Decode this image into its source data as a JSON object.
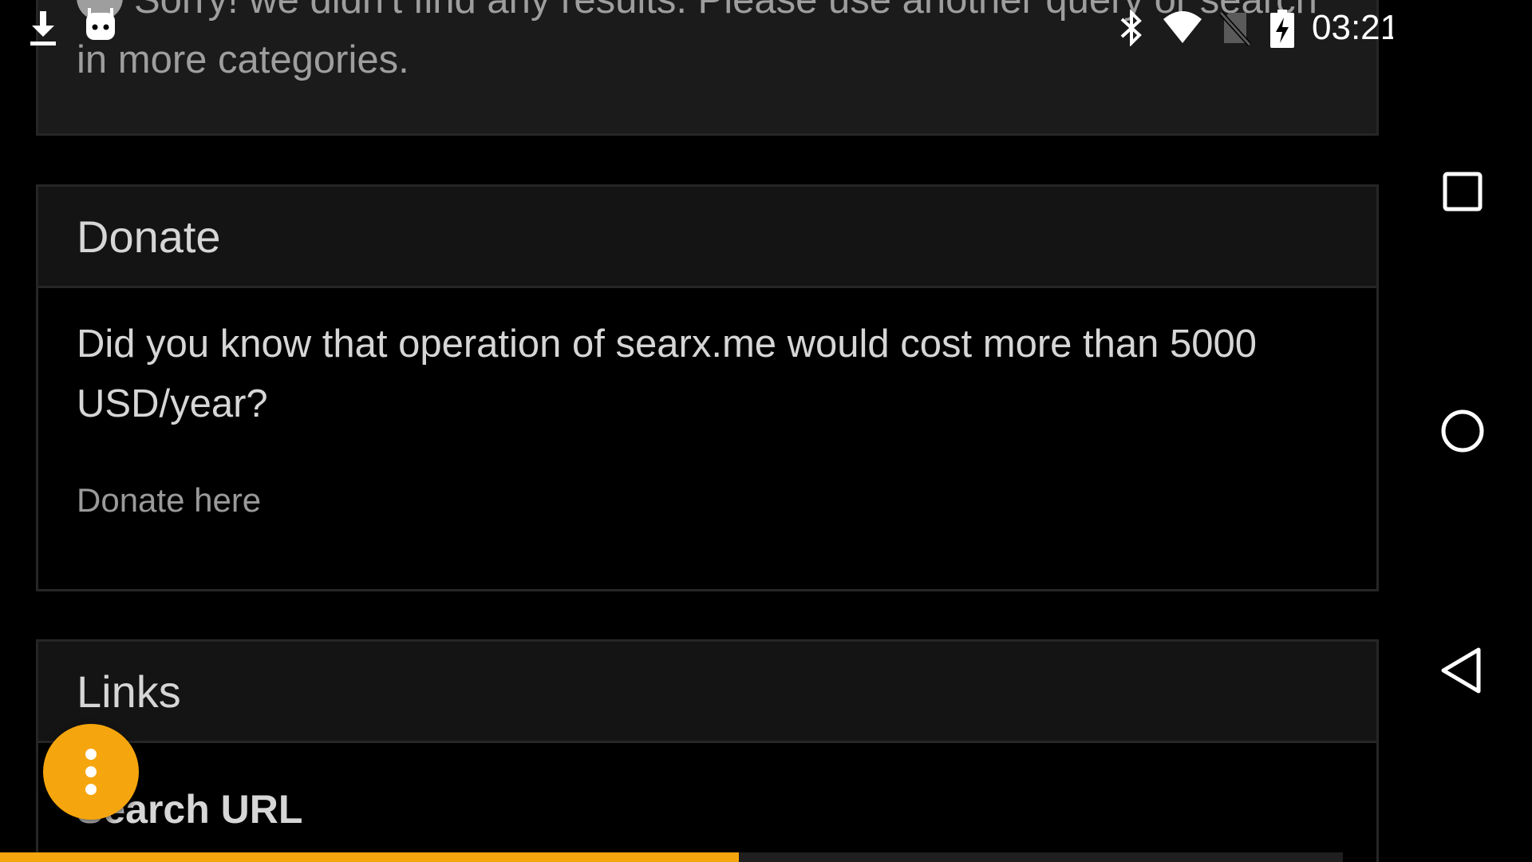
{
  "status_bar": {
    "time": "03:21",
    "left_icons": [
      "download-icon",
      "android-debug-icon"
    ],
    "right_icons": [
      "bluetooth-icon",
      "wifi-icon",
      "no-sim-icon",
      "battery-charging-icon"
    ]
  },
  "results": {
    "no_results_message": "Sorry! we didn't find any results. Please use another query or search in more categories."
  },
  "donate": {
    "title": "Donate",
    "text": "Did you know that operation of searx.me would cost more than 5000 USD/year?",
    "link_label": "Donate here"
  },
  "links": {
    "title": "Links",
    "subheading": "Search URL"
  },
  "page_load_progress": 0.55,
  "nav_bar": {
    "buttons": [
      "recents-button",
      "home-button",
      "back-button"
    ]
  },
  "colors": {
    "accent": "#f5a50d",
    "background": "#000000",
    "panel_heading": "#141414"
  }
}
